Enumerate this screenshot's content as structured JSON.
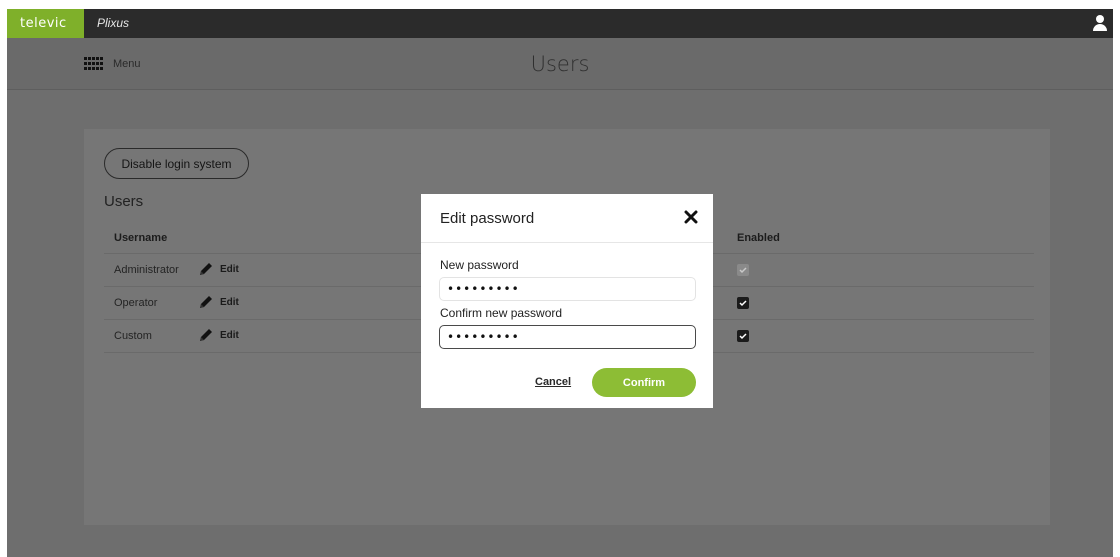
{
  "topbar": {
    "brand": "televic",
    "product": "Plixus",
    "user_icon": "user-icon"
  },
  "header": {
    "menu_label": "Menu",
    "menu_icon": "grid-menu-icon",
    "title": "Users"
  },
  "panel": {
    "disable_button": "Disable login system",
    "heading": "Users",
    "columns": {
      "username": "Username",
      "enabled": "Enabled"
    },
    "rows": [
      {
        "username": "Administrator",
        "edit_label": "Edit",
        "enabled": true,
        "enabled_disabled": true
      },
      {
        "username": "Operator",
        "edit_label": "Edit",
        "enabled": true,
        "enabled_disabled": false
      },
      {
        "username": "Custom",
        "edit_label": "Edit",
        "enabled": true,
        "enabled_disabled": false
      }
    ]
  },
  "modal": {
    "title": "Edit password",
    "close_icon": "close-icon",
    "new_password_label": "New password",
    "new_password_value": "•••••••••",
    "confirm_password_label": "Confirm new password",
    "confirm_password_value": "•••••••••",
    "cancel_label": "Cancel",
    "confirm_label": "Confirm"
  },
  "colors": {
    "brand_green": "#7fb02a",
    "confirm_green": "#8dbd35",
    "topbar": "#2b2b2b",
    "overlay_gray": "#6e6e6e"
  }
}
